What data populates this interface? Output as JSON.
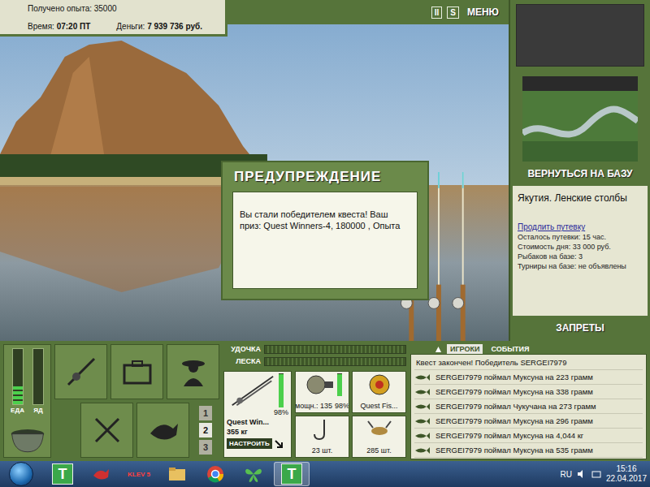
{
  "hud": {
    "experience": "Получено опыта: 35000",
    "time_label": "Время:",
    "time": "07:20 ПТ",
    "money_label": "Деньги:",
    "money": "7 939 736 руб."
  },
  "top_bar": {
    "buttons": [
      {
        "kind": "pause",
        "label": "II"
      },
      {
        "kind": "sound",
        "label": "S"
      },
      {
        "kind": "menu",
        "label": "МЕНЮ"
      }
    ]
  },
  "dialog": {
    "title": "ПРЕДУПРЕЖДЕНИЕ",
    "message": "Вы стали победителем квеста! Ваш приз: Quest Winners-4, 180000 , Опыта"
  },
  "sidebar": {
    "return_button": "ВЕРНУТЬСЯ НА БАЗУ",
    "location": "Якутия. Ленские столбы",
    "extend_link": "Продлить путевку",
    "info": [
      "Осталось путевки: 15 час.",
      "Стоимость дня: 33 000 руб.",
      "Рыбаков на базе: 3",
      "Турниры на базе: не объявлены"
    ],
    "bans_button": "ЗАПРЕТЫ"
  },
  "needs": [
    {
      "label": "ЕДА",
      "level": 0.35
    },
    {
      "label": "ЯД",
      "level": 0
    }
  ],
  "slots": [
    {
      "label": "1",
      "selected": false
    },
    {
      "label": "2",
      "selected": true
    },
    {
      "label": "3",
      "selected": false
    }
  ],
  "gauges": [
    {
      "label": "УДОЧКА",
      "level": 0
    },
    {
      "label": "ЛЕСКА",
      "level": 0
    }
  ],
  "tackle": {
    "rod": {
      "name": "Quest Win...",
      "load": "355 кг",
      "wear": "98%",
      "level": 0.98,
      "button": "НАСТРОИТЬ"
    },
    "reel": {
      "power": "мощн.: 135",
      "wear": "98%",
      "level": 0.98
    },
    "line": {
      "name": "Quest Fis..."
    },
    "hook": {
      "count": "23 шт."
    },
    "bait": {
      "count": "285 шт."
    }
  },
  "events": {
    "tabs": [
      {
        "label": "ИГРОКИ",
        "selected": true
      },
      {
        "label": "СОБЫТИЯ",
        "selected": false
      }
    ],
    "rows": [
      {
        "kind": "notice",
        "text": "Квест закончен! Победитель SERGEI7979"
      },
      {
        "kind": "catch",
        "text": "SERGEI7979 поймал Муксуна на 223 грамм"
      },
      {
        "kind": "catch",
        "text": "SERGEI7979 поймал Муксуна на 338 грамм"
      },
      {
        "kind": "catch",
        "text": "SERGEI7979 поймал Чукучана на 273 грамм"
      },
      {
        "kind": "catch",
        "text": "SERGEI7979 поймал Муксуна на 296 грамм"
      },
      {
        "kind": "catch",
        "text": "SERGEI7979 поймал Муксуна на 4,044 кг"
      },
      {
        "kind": "catch",
        "text": "SERGEI7979 поймал Муксуна на 535 грамм"
      }
    ]
  },
  "taskbar": {
    "apps": [
      {
        "kind": "letter",
        "label": "T",
        "active": false
      },
      {
        "kind": "fish",
        "active": false
      },
      {
        "kind": "klev",
        "label": "KLEV 5",
        "active": false
      },
      {
        "kind": "folder",
        "active": false
      },
      {
        "kind": "chrome",
        "active": false
      },
      {
        "kind": "butterfly",
        "active": false
      },
      {
        "kind": "letter",
        "label": "T",
        "active": true
      }
    ],
    "language": "RU",
    "time": "15:16",
    "date": "22.04.2017"
  }
}
